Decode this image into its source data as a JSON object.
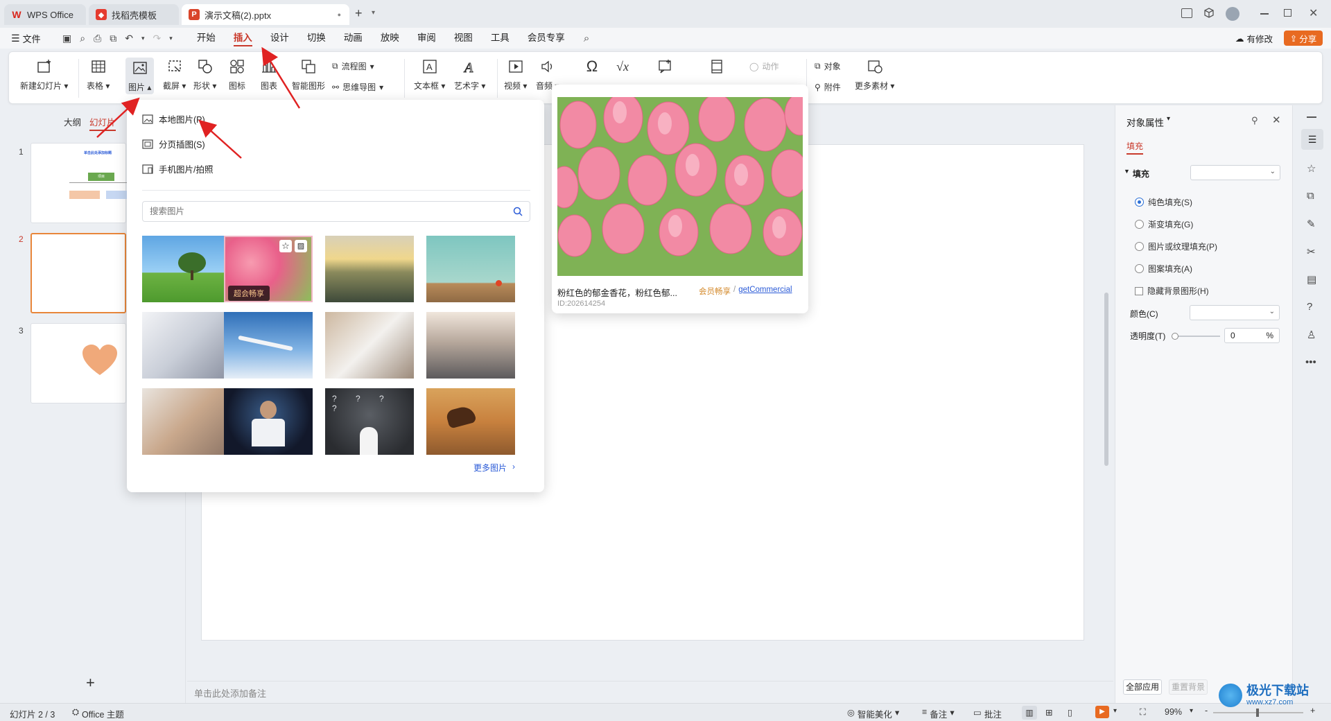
{
  "titlebar": {
    "tabs": [
      {
        "label": "WPS Office",
        "icon": "wps-logo-icon"
      },
      {
        "label": "找稻壳模板",
        "icon": "docer-icon"
      },
      {
        "label": "演示文稿(2).pptx",
        "icon": "ppt-file-icon"
      }
    ],
    "new_tab": "+"
  },
  "menubar": {
    "file": "文件",
    "items": [
      "开始",
      "插入",
      "设计",
      "切换",
      "动画",
      "放映",
      "审阅",
      "视图",
      "工具",
      "会员专享"
    ],
    "active": "插入",
    "changes": "有修改",
    "share": "分享"
  },
  "ribbon": {
    "new_slide": "新建幻灯片",
    "table": "表格",
    "picture": "图片",
    "screenshot": "截屏",
    "shape": "形状",
    "icon": "图标",
    "chart": "图表",
    "smart_art": "智能图形",
    "flowchart": "流程图",
    "mindmap": "思维导图",
    "textbox": "文本框",
    "wordart": "艺术字",
    "video": "视频",
    "audio": "音频",
    "action": "动作",
    "object": "对象",
    "attachment": "附件",
    "more_materials": "更多素材"
  },
  "left_panel": {
    "tab_outline": "大纲",
    "tab_slides": "幻灯片",
    "slide_numbers": [
      "1",
      "2",
      "3"
    ],
    "slide1_title": "单击此处添加标题",
    "slide1_box": "项目",
    "add_slide": "+"
  },
  "picture_menu": {
    "local": "本地图片(P)",
    "paged": "分页插图(S)",
    "phone": "手机图片/拍照",
    "search_placeholder": "搜索图片",
    "vip_badge": "超会畅享",
    "more": "更多图片"
  },
  "preview": {
    "caption": "粉红色的郁金香花，粉红色郁...",
    "vip": "会员畅享",
    "separator": "/",
    "license": "getCommercial",
    "id": "ID:202614254"
  },
  "right_panel": {
    "title": "对象属性",
    "tab_fill": "填充",
    "fill_section": "填充",
    "options": [
      "纯色填充(S)",
      "渐变填充(G)",
      "图片或纹理填充(P)",
      "图案填充(A)"
    ],
    "selected": 0,
    "hide_bg": "隐藏背景图形(H)",
    "color_label": "颜色(C)",
    "transparency_label": "透明度(T)",
    "transparency_value": "0",
    "percent": "%",
    "apply_all": "全部应用",
    "reset_bg": "重置背景"
  },
  "notes": {
    "placeholder": "单击此处添加备注"
  },
  "statusbar": {
    "slide_info": "幻灯片 2 / 3",
    "theme": "Office 主题",
    "beautify": "智能美化",
    "notes": "备注",
    "comments": "批注",
    "zoom": "99%",
    "zoom_out": "-",
    "zoom_in": "+"
  },
  "watermark": {
    "text": "极光下载站",
    "url": "www.xz7.com"
  },
  "colors": {
    "accent": "#c93a2c",
    "share_btn": "#e86a21",
    "link": "#2b5bd7",
    "vip": "#d48a2c"
  }
}
